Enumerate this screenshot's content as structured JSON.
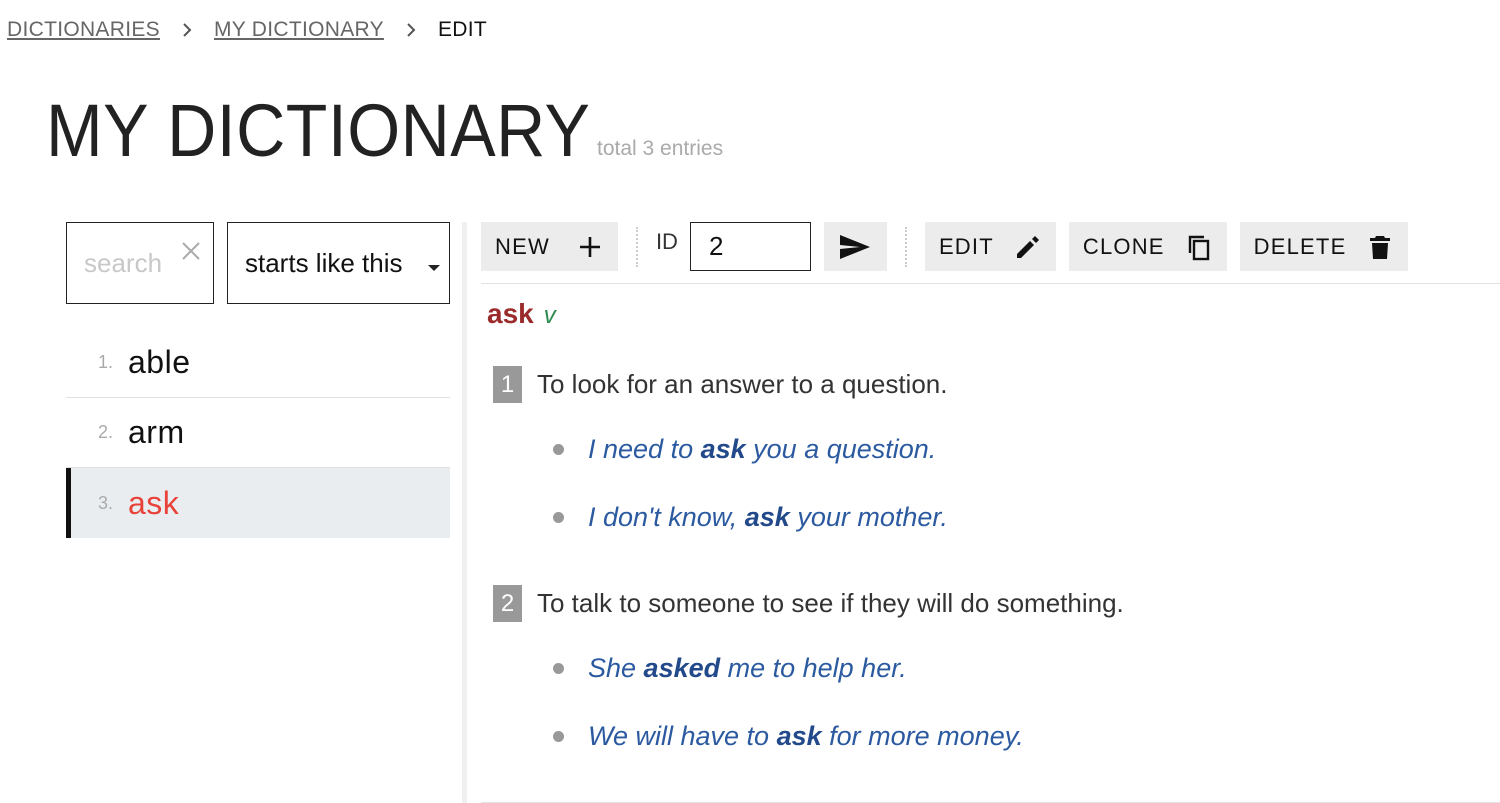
{
  "breadcrumb": {
    "items": [
      {
        "label": "DICTIONARIES"
      },
      {
        "label": "MY DICTIONARY"
      }
    ],
    "current": "EDIT"
  },
  "page": {
    "title": "MY DICTIONARY",
    "entry_count": "total 3 entries"
  },
  "search": {
    "placeholder": "search",
    "value": "",
    "mode": "starts like this"
  },
  "word_list": [
    {
      "num": "1.",
      "word": "able"
    },
    {
      "num": "2.",
      "word": "arm"
    },
    {
      "num": "3.",
      "word": "ask"
    }
  ],
  "toolbar": {
    "new_label": "NEW",
    "id_label": "ID",
    "id_value": "2",
    "edit_label": "EDIT",
    "clone_label": "CLONE",
    "delete_label": "DELETE"
  },
  "entry": {
    "headword": "ask",
    "pos": "v",
    "senses": [
      {
        "num": "1",
        "definition": "To look for an answer to a question.",
        "examples": [
          {
            "before": "I need to ",
            "keyword": "ask",
            "after": " you a question."
          },
          {
            "before": "I don't know, ",
            "keyword": "ask",
            "after": " your mother."
          }
        ]
      },
      {
        "num": "2",
        "definition": "To talk to someone to see if they will do something.",
        "examples": [
          {
            "before": "She ",
            "keyword": "asked",
            "after": " me to help her."
          },
          {
            "before": "We will have to ",
            "keyword": "ask",
            "after": " for more money."
          }
        ]
      }
    ]
  },
  "colors": {
    "headword": "#9b2a2a",
    "pos": "#2e8a4e",
    "example": "#2b5aa0",
    "selected_word": "#e8423a",
    "selected_bg": "#eaedf0"
  },
  "icons": {
    "breadcrumb_separator": "chevron-right-icon",
    "clear": "close-icon",
    "new": "plus-icon",
    "go": "send-icon",
    "edit": "pencil-icon",
    "clone": "copy-icon",
    "delete": "trash-icon"
  }
}
